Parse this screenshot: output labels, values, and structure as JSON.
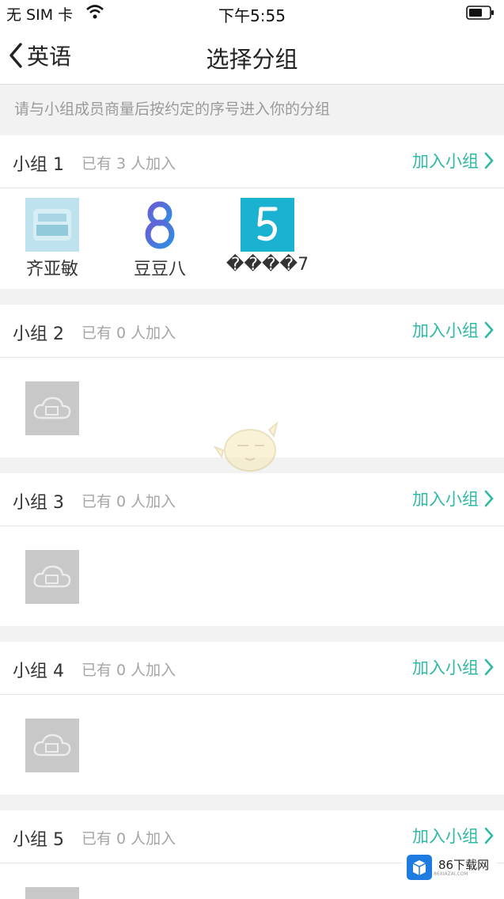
{
  "status": {
    "carrier": "无 SIM 卡",
    "time": "下午5:55"
  },
  "nav": {
    "back_label": "英语",
    "title": "选择分组"
  },
  "hint": "请与小组成员商量后按约定的序号进入你的分组",
  "groups": [
    {
      "name": "小组 1",
      "count": "已有 3 人加入",
      "join": "加入小组",
      "members": [
        {
          "name": "齐亚敏"
        },
        {
          "name": "豆豆八"
        },
        {
          "name": "����7"
        }
      ]
    },
    {
      "name": "小组 2",
      "count": "已有 0 人加入",
      "join": "加入小组"
    },
    {
      "name": "小组 3",
      "count": "已有 0 人加入",
      "join": "加入小组"
    },
    {
      "name": "小组 4",
      "count": "已有 0 人加入",
      "join": "加入小组"
    },
    {
      "name": "小组 5",
      "count": "已有 0 人加入",
      "join": "加入小组"
    }
  ],
  "watermark": {
    "text": "86下载网",
    "sub": "86XIAZAI.COM"
  },
  "colors": {
    "accent": "#2fb9a6",
    "placeholder": "#c8c8c8"
  },
  "icons": [
    "wifi-icon",
    "battery-icon",
    "chevron-left-icon",
    "chevron-right-icon",
    "cloud-placeholder-icon"
  ]
}
